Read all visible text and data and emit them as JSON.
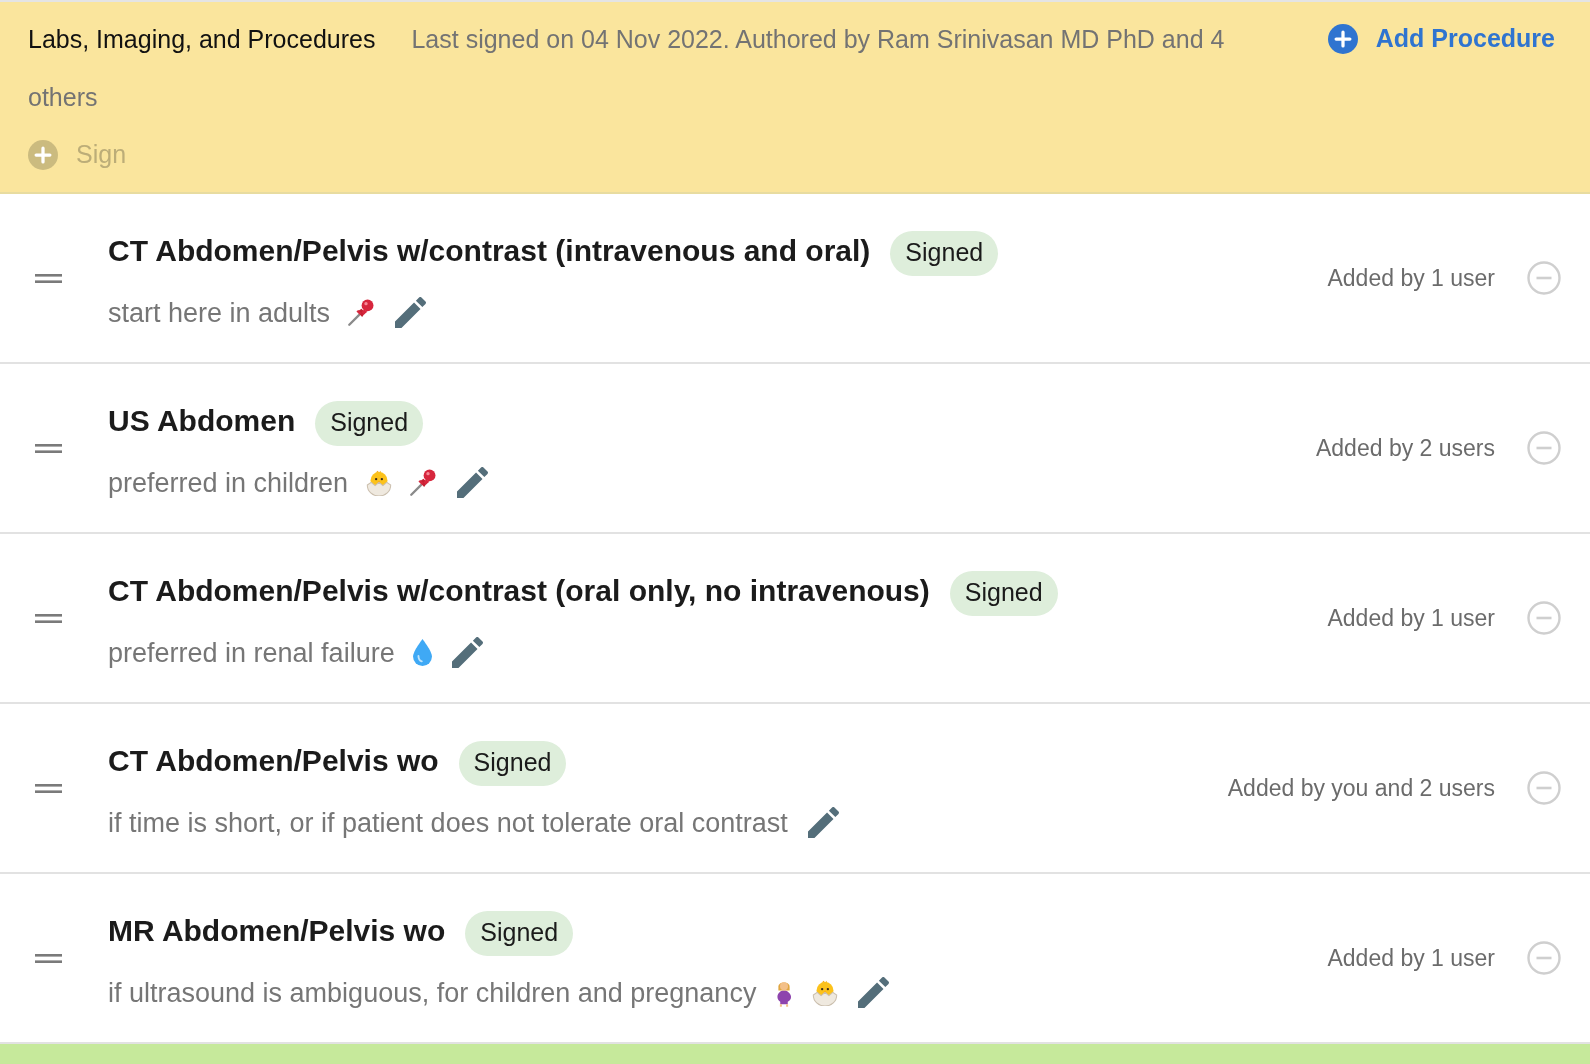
{
  "header": {
    "title": "Labs, Imaging, and Procedures",
    "signature_note": "Last signed on 04 Nov 2022. Authored by Ram Srinivasan MD PhD and 4 others",
    "add_button": {
      "label": "Add Procedure"
    },
    "sign_button": {
      "label": "Sign",
      "disabled": true
    }
  },
  "procedures": [
    {
      "title": "CT Abdomen/Pelvis w/contrast (intravenous and oral)",
      "status": "Signed",
      "note": "start here in adults",
      "markers": [
        {
          "kind": "pushpin"
        }
      ],
      "added_by": "Added by 1 user"
    },
    {
      "title": "US Abdomen",
      "status": "Signed",
      "note": "preferred in children",
      "markers": [
        {
          "kind": "hatching-chick"
        },
        {
          "kind": "pushpin"
        }
      ],
      "added_by": "Added by 2 users"
    },
    {
      "title": "CT Abdomen/Pelvis w/contrast (oral only, no intravenous)",
      "status": "Signed",
      "note": "preferred in renal failure",
      "markers": [
        {
          "kind": "droplet"
        }
      ],
      "added_by": "Added by 1 user"
    },
    {
      "title": "CT Abdomen/Pelvis wo",
      "status": "Signed",
      "note": "if time is short, or if patient does not tolerate oral contrast",
      "added_by": "Added by you and 2 users"
    },
    {
      "title": "MR Abdomen/Pelvis wo",
      "status": "Signed",
      "note": "if ultrasound is ambiguous, for children and pregnancy",
      "markers": [
        {
          "kind": "pregnant-person"
        },
        {
          "kind": "hatching-chick"
        }
      ],
      "added_by": "Added by 1 user"
    }
  ]
}
